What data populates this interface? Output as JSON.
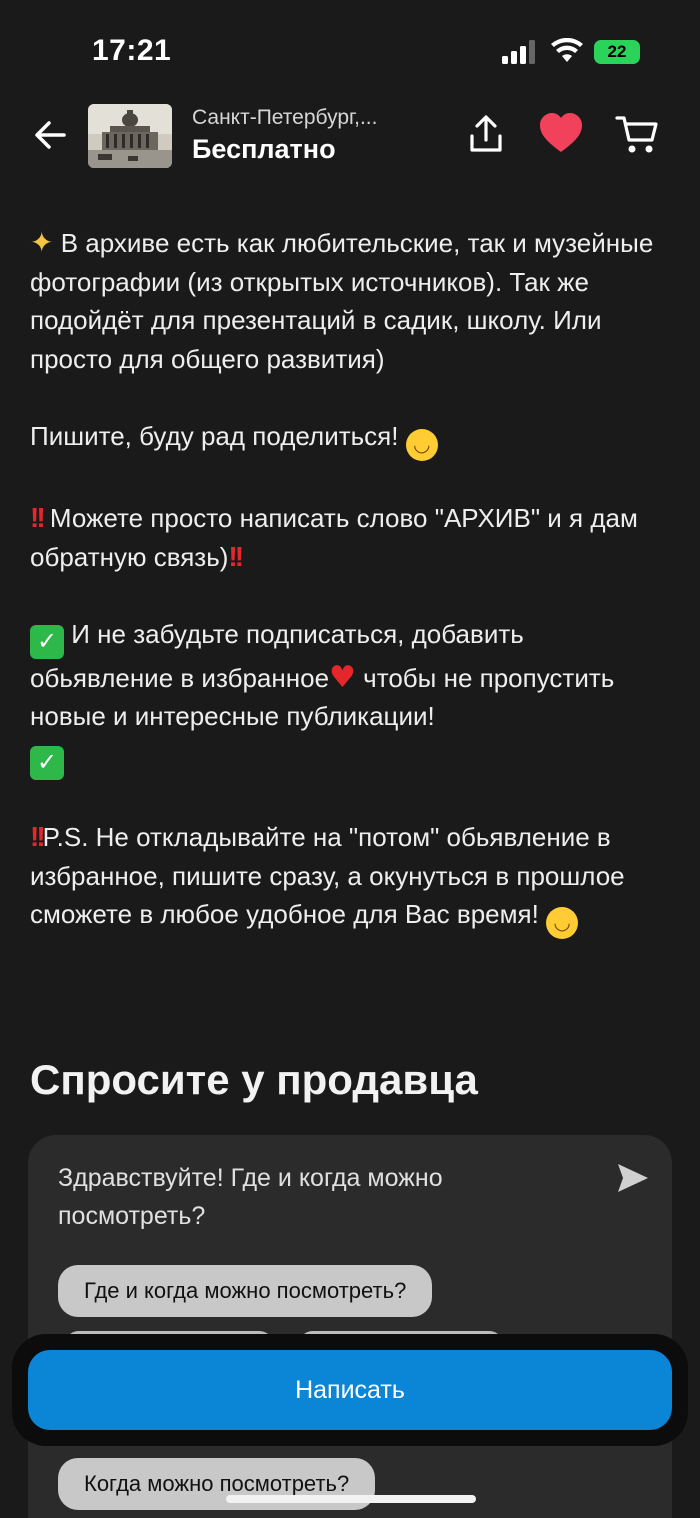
{
  "status_bar": {
    "time": "17:21",
    "battery": "22"
  },
  "header": {
    "location": "Санкт-Петербург,...",
    "price": "Бесплатно"
  },
  "description": {
    "cut_text": "- - - - - - - - - - - - - - - - - - - - - - - - - -",
    "p1": "В архиве есть как любительские, так и музейные фотографии (из открытых источников). Так же подойдёт для презентаций в садик, школу. Или просто для общего развития)",
    "p2": "Пишите, буду рад поделиться!",
    "p3": "Можете просто написать слово \"АРХИВ\" и я дам обратную связь)",
    "p4_a": "И не забудьте подписаться, добавить обьявление в избранное",
    "p4_b": " чтобы не пропустить новые и интересные публикации!",
    "p5": "P.S. Не откладывайте на \"потом\" обьявление в избранное, пишите сразу, а окунуться в прошлое сможете в любое удобное для Вас время!"
  },
  "ask_seller": {
    "title": "Спросите у продавца",
    "message": "Здравствуйте! Где и когда можно посмотреть?",
    "chips": [
      "Где и когда можно посмотреть?",
      "Когда можно посмотреть?"
    ]
  },
  "actions": {
    "write_label": "Написать"
  },
  "colors": {
    "accent_blue": "#0b86d6",
    "favorite_red": "#e5262b",
    "battery_green": "#2bd35a",
    "background": "#1a1a1a"
  },
  "icons": [
    "back-arrow-icon",
    "share-icon",
    "heart-icon",
    "cart-icon",
    "send-icon",
    "signal-icon",
    "wifi-icon",
    "battery-icon"
  ]
}
